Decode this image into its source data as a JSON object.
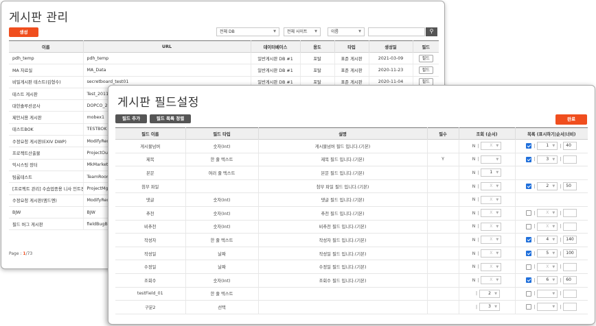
{
  "board_admin": {
    "title": "게시판 관리",
    "create_label": "생성",
    "filter_db": "전체 DB",
    "filter_site": "전체 사이트",
    "filter_field": "이름",
    "search_value": "",
    "columns": [
      "이름",
      "URL",
      "데이터베이스",
      "용도",
      "타입",
      "생성일",
      "필드"
    ],
    "rows": [
      {
        "name": "pdh_temp",
        "url": "pdh_temp",
        "db": "일반게시판 DB #1",
        "usage": "포탈",
        "type": "표준 게시판",
        "created": "2021-03-09",
        "field": "필드"
      },
      {
        "name": "MA 자료실",
        "url": "MA_Data",
        "db": "일반게시판 DB #1",
        "usage": "포탈",
        "type": "표준 게시판",
        "created": "2020-11-23",
        "field": "필드"
      },
      {
        "name": "비밀게시판 테스트(김형수)",
        "url": "secretboard_test01",
        "db": "일반게시판 DB #1",
        "usage": "포탈",
        "type": "표준 게시판",
        "created": "2020-11-04",
        "field": "필드"
      },
      {
        "name": "테스트 게시판",
        "url": "Test_20110",
        "db": "",
        "usage": "",
        "type": "",
        "created": "",
        "field": ""
      },
      {
        "name": "대한솔루션공사",
        "url": "DOPCO_20",
        "db": "",
        "usage": "",
        "type": "",
        "created": "",
        "field": ""
      },
      {
        "name": "제안서용 게시판",
        "url": "mobex1",
        "db": "",
        "usage": "",
        "type": "",
        "created": "",
        "field": ""
      },
      {
        "name": "테스트BOK",
        "url": "TESTBOK",
        "db": "",
        "usage": "",
        "type": "",
        "created": "",
        "field": ""
      },
      {
        "name": "수정요청 게시판(EXIV DWP)",
        "url": "ModifyReq",
        "db": "",
        "usage": "",
        "type": "",
        "created": "",
        "field": ""
      },
      {
        "name": "프로젝트산출물",
        "url": "ProjectOut",
        "db": "",
        "usage": "",
        "type": "",
        "created": "",
        "field": ""
      },
      {
        "name": "익시스팅 장터",
        "url": "MkMarket",
        "db": "",
        "usage": "",
        "type": "",
        "created": "",
        "field": ""
      },
      {
        "name": "팀룸테스트",
        "url": "TeamRoom",
        "db": "",
        "usage": "",
        "type": "",
        "created": "",
        "field": ""
      },
      {
        "name": "[프로젝트 관리] 수습업종용 니사 인트전",
        "url": "ProjectMgr",
        "db": "",
        "usage": "",
        "type": "",
        "created": "",
        "field": ""
      },
      {
        "name": "수정요청 게시판(엠드엔)",
        "url": "ModifyReq",
        "db": "",
        "usage": "",
        "type": "",
        "created": "",
        "field": ""
      },
      {
        "name": "BJW",
        "url": "BJW",
        "db": "",
        "usage": "",
        "type": "",
        "created": "",
        "field": ""
      },
      {
        "name": "필드 버그 게시판",
        "url": "fieldBugBoa",
        "db": "",
        "usage": "",
        "type": "",
        "created": "",
        "field": ""
      }
    ],
    "pager": {
      "label": "Page :",
      "current": "1",
      "total": "/73"
    }
  },
  "field_settings": {
    "title": "게시판 필드설정",
    "add_field_label": "필드 추가",
    "sort_fields_label": "필드 목록 정렬",
    "done_label": "완료",
    "columns": [
      "필드 이름",
      "필드 타입",
      "설명",
      "필수",
      "조회 (순서)",
      "목록 (표시하기|순서|너비)"
    ],
    "rows": [
      {
        "name": "게시물넘버",
        "type": "숫자(Int)",
        "desc": "게시물넘버 필드 입니다.(기본)",
        "required": "",
        "view_n": "N",
        "view_order": "X",
        "list_checked": true,
        "list_order": "1",
        "list_width": "40"
      },
      {
        "name": "제목",
        "type": "한 줄 텍스트",
        "desc": "제목 필드 입니다.(기본)",
        "required": "Y",
        "view_n": "N",
        "view_order": "",
        "list_checked": true,
        "list_order": "3",
        "list_width": ""
      },
      {
        "name": "본문",
        "type": "여러 줄 텍스트",
        "desc": "본문 필드 입니다.(기본)",
        "required": "",
        "view_n": "N",
        "view_order": "1",
        "list_checked": false,
        "list_order": "",
        "list_width": "",
        "list_hidden": true
      },
      {
        "name": "첨부 파일",
        "type": "",
        "desc": "첨부 파일 필드 입니다.(기본)",
        "required": "",
        "view_n": "N",
        "view_order": "X",
        "list_checked": true,
        "list_order": "2",
        "list_width": "50"
      },
      {
        "name": "댓글",
        "type": "숫자(Int)",
        "desc": "댓글 필드 입니다.(기본)",
        "required": "",
        "view_n": "N",
        "view_order": "X",
        "list_checked": false,
        "list_order": "",
        "list_width": "",
        "list_hidden": true
      },
      {
        "name": "추천",
        "type": "숫자(Int)",
        "desc": "추천 필드 입니다.(기본)",
        "required": "",
        "view_n": "N",
        "view_order": "X",
        "list_checked": false,
        "list_order": "X",
        "list_width": ""
      },
      {
        "name": "비추천",
        "type": "숫자(Int)",
        "desc": "비추천 필드 입니다.(기본)",
        "required": "",
        "view_n": "N",
        "view_order": "X",
        "list_checked": false,
        "list_order": "X",
        "list_width": ""
      },
      {
        "name": "작성자",
        "type": "한 줄 텍스트",
        "desc": "작성자 필드 입니다.(기본)",
        "required": "",
        "view_n": "N",
        "view_order": "X",
        "list_checked": true,
        "list_order": "4",
        "list_width": "140"
      },
      {
        "name": "작성일",
        "type": "날짜",
        "desc": "작성일 필드 입니다.(기본)",
        "required": "",
        "view_n": "N",
        "view_order": "X",
        "list_checked": true,
        "list_order": "5",
        "list_width": "100"
      },
      {
        "name": "수정일",
        "type": "날짜",
        "desc": "수정일 필드 입니다.(기본)",
        "required": "",
        "view_n": "N",
        "view_order": "X",
        "list_checked": false,
        "list_order": "X",
        "list_width": ""
      },
      {
        "name": "조회수",
        "type": "숫자(Int)",
        "desc": "조회수 필드 입니다.(기본)",
        "required": "",
        "view_n": "N",
        "view_order": "X",
        "list_checked": true,
        "list_order": "6",
        "list_width": "60"
      },
      {
        "name": "testField_01",
        "type": "한 줄 텍스트",
        "desc": "",
        "required": "",
        "view_n": "",
        "view_order": "2",
        "list_checked": false,
        "list_order": "",
        "list_width": ""
      },
      {
        "name": "구분2",
        "type": "선택",
        "desc": "",
        "required": "",
        "view_n": "",
        "view_order": "3",
        "list_checked": false,
        "list_order": "",
        "list_width": ""
      }
    ]
  },
  "colors": {
    "accent": "#f04e1e",
    "dark_button": "#555555",
    "checkbox": "#1f6fdb"
  }
}
